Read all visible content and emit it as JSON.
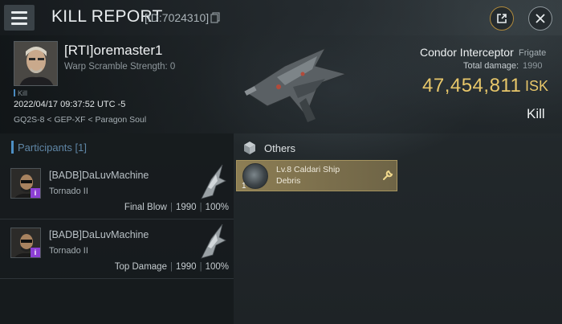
{
  "header": {
    "title": "KILL REPORT",
    "kill_id": "[ID:7024310]"
  },
  "victim": {
    "name": "[RTI]oremaster1",
    "warp_scramble": "Warp Scramble Strength: 0",
    "kill_tag": "Kill",
    "date": "2022/04/17 09:37:52 UTC -5",
    "location": "GQ2S-8 < GEP-XF < Paragon Soul",
    "ship_name": "Condor Interceptor",
    "ship_class": "Frigate",
    "total_damage_label": "Total damage:",
    "total_damage_value": "1990",
    "isk_value": "47,454,811",
    "isk_unit": "ISK",
    "status": "Kill"
  },
  "participants": {
    "title": "Participants [1]",
    "rows": [
      {
        "name": "[BADB]DaLuvMachine",
        "ship": "Tornado II",
        "role": "Final Blow",
        "damage": "1990",
        "percent": "100%",
        "badge": "i"
      },
      {
        "name": "[BADB]DaLuvMachine",
        "ship": "Tornado II",
        "role": "Top Damage",
        "damage": "1990",
        "percent": "100%",
        "badge": "i"
      }
    ]
  },
  "others": {
    "title": "Others",
    "items": [
      {
        "qty": "1",
        "name": "Lv.8 Caldari Ship Debris"
      }
    ]
  },
  "colors": {
    "isk_gold": "#e8c76a",
    "participants_accent": "#4d8fc4",
    "badge_purple": "#8c3fd4",
    "item_card": "#8d7e54"
  },
  "icons": {
    "menu": "menu-icon",
    "copy": "copy-icon",
    "share": "share-icon",
    "close": "close-icon",
    "others": "cube-icon",
    "wrench": "wrench-icon"
  }
}
